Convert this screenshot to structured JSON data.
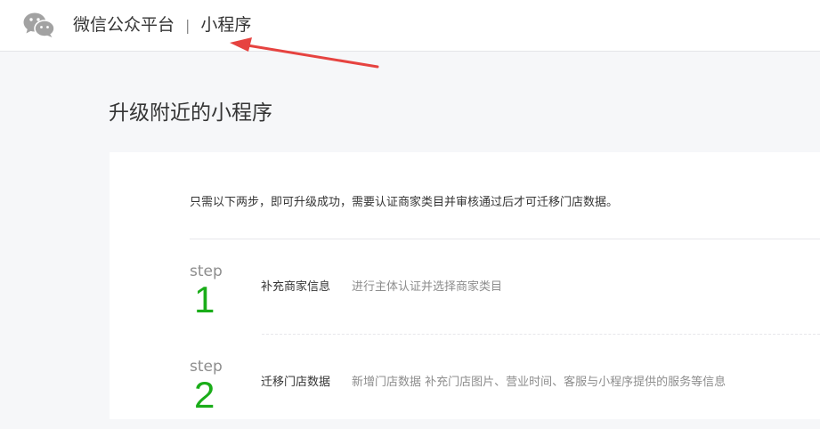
{
  "header": {
    "brand": "微信公众平台",
    "separator": "|",
    "section": "小程序",
    "logo_icon": "wechat-logo-icon"
  },
  "annotation": {
    "arrow_color": "#e64340"
  },
  "main": {
    "title": "升级附近的小程序",
    "intro": "只需以下两步，即可升级成功，需要认证商家类目并审核通过后才可迁移门店数据。",
    "steps": [
      {
        "label": "step",
        "number": "1",
        "title": "补充商家信息",
        "description": "进行主体认证并选择商家类目"
      },
      {
        "label": "step",
        "number": "2",
        "title": "迁移门店数据",
        "description": "新增门店数据 补充门店图片、营业时间、客服与小程序提供的服务等信息"
      }
    ]
  },
  "colors": {
    "accent_green": "#1aad19",
    "text_primary": "#353535",
    "text_secondary": "#8d8d8d",
    "page_background": "#f6f7f9"
  }
}
